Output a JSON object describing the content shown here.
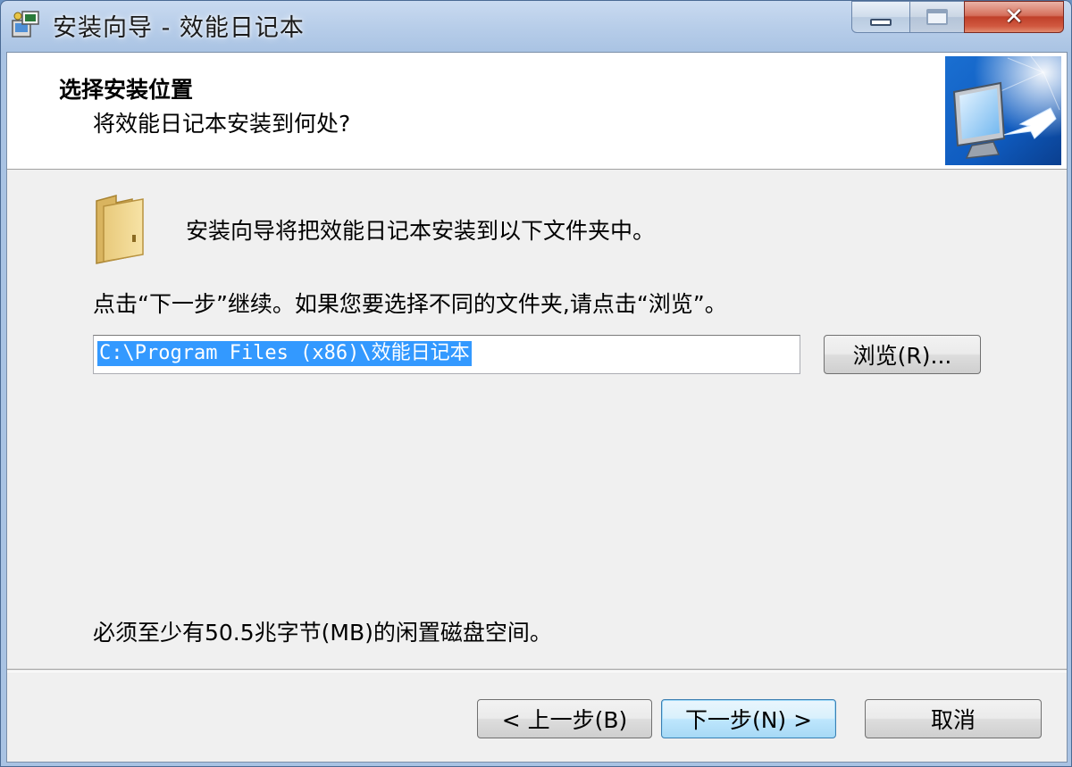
{
  "window": {
    "title": "安装向导 - 效能日记本",
    "close_glyph": "✕"
  },
  "header": {
    "title": "选择安装位置",
    "subtitle": "将效能日记本安装到何处?"
  },
  "main": {
    "intro": "安装向导将把效能日记本安装到以下文件夹中。",
    "instruction": "点击“下一步”继续。如果您要选择不同的文件夹,请点击“浏览”。",
    "install_path": "C:\\Program Files (x86)\\效能日记本",
    "browse_label": "浏览(R)...",
    "space_required": "必须至少有50.5兆字节(MB)的闲置磁盘空间。"
  },
  "footer": {
    "back_label": "< 上一步(B)",
    "next_label": "下一步(N) >",
    "cancel_label": "取消"
  },
  "icons": {
    "app": "installer-app-icon",
    "header_image": "computer-install-icon",
    "folder": "folder-icon"
  },
  "colors": {
    "selection": "#3399ff",
    "close_button": "#c0402a",
    "default_button_border": "#3c7fb1"
  }
}
